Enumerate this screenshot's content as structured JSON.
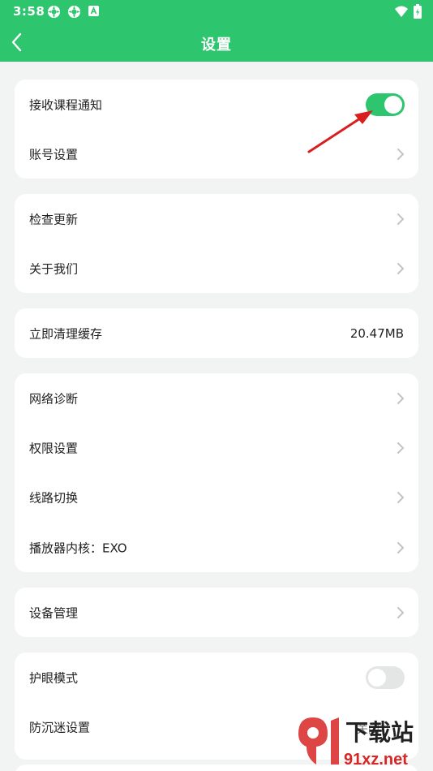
{
  "status": {
    "time": "3:58",
    "icons": [
      "settings-gear-icon",
      "settings-gear-icon",
      "notification-a-icon"
    ],
    "right_icons": [
      "wifi-icon",
      "battery-icon"
    ]
  },
  "header": {
    "title": "设置",
    "color": "#2ec56f"
  },
  "groups": [
    {
      "rows": [
        {
          "label": "接收课程通知",
          "control": "toggle",
          "on": true
        },
        {
          "label": "账号设置",
          "control": "chevron"
        }
      ]
    },
    {
      "rows": [
        {
          "label": "检查更新",
          "control": "chevron"
        },
        {
          "label": "关于我们",
          "control": "chevron"
        }
      ]
    },
    {
      "rows": [
        {
          "label": "立即清理缓存",
          "control": "value",
          "value": "20.47MB"
        }
      ]
    },
    {
      "rows": [
        {
          "label": "网络诊断",
          "control": "chevron"
        },
        {
          "label": "权限设置",
          "control": "chevron"
        },
        {
          "label": "线路切换",
          "control": "chevron"
        },
        {
          "label": "播放器内核：EXO",
          "control": "chevron"
        }
      ]
    },
    {
      "rows": [
        {
          "label": "设备管理",
          "control": "chevron"
        }
      ]
    },
    {
      "rows": [
        {
          "label": "护眼模式",
          "control": "toggle",
          "on": false
        },
        {
          "label": "防沉迷设置",
          "control": "value",
          "value": "关闭"
        }
      ]
    }
  ],
  "annotation": {
    "arrow_color": "#e02020",
    "points_to": "接收课程通知 toggle"
  },
  "watermark": {
    "text": "下载站",
    "url_text": "91xz.net",
    "logo": "91"
  }
}
